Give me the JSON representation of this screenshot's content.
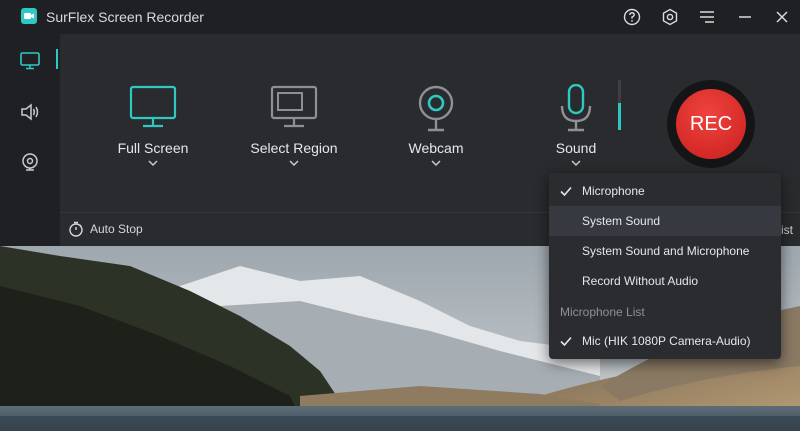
{
  "app": {
    "title": "SurFlex Screen Recorder"
  },
  "titlebar": {
    "buttons": [
      {
        "icon": "help-icon"
      },
      {
        "icon": "settings-icon"
      },
      {
        "icon": "menu-icon"
      },
      {
        "icon": "minimize-icon"
      },
      {
        "icon": "close-icon"
      }
    ]
  },
  "sidebar": {
    "items": [
      {
        "icon": "monitor-icon",
        "selected": true
      },
      {
        "icon": "speaker-icon",
        "selected": false
      },
      {
        "icon": "webcam-icon",
        "selected": false
      }
    ]
  },
  "modes": [
    {
      "label": "Full Screen",
      "icon": "full-screen-icon",
      "active": true
    },
    {
      "label": "Select Region",
      "icon": "select-region-icon",
      "active": false
    },
    {
      "label": "Webcam",
      "icon": "webcam-icon",
      "active": true
    },
    {
      "label": "Sound",
      "icon": "microphone-icon",
      "active": true
    }
  ],
  "volume_level": 0.55,
  "rec_button": {
    "label": "REC"
  },
  "bottom_strip": {
    "auto_stop_label": "Auto Stop",
    "right_label": "ist"
  },
  "sound_menu": {
    "items": [
      {
        "label": "Microphone",
        "checked": true
      },
      {
        "label": "System Sound",
        "checked": false
      },
      {
        "label": "System Sound and Microphone",
        "checked": false
      },
      {
        "label": "Record Without Audio",
        "checked": false
      }
    ],
    "list_header": "Microphone List",
    "devices": [
      {
        "label": "Mic (HIK 1080P Camera-Audio)",
        "checked": true
      }
    ]
  },
  "colors": {
    "accent": "#2ec9c3",
    "rec": "#e8312e",
    "panel": "#2a2b2e",
    "titlebar": "#1f2023"
  }
}
